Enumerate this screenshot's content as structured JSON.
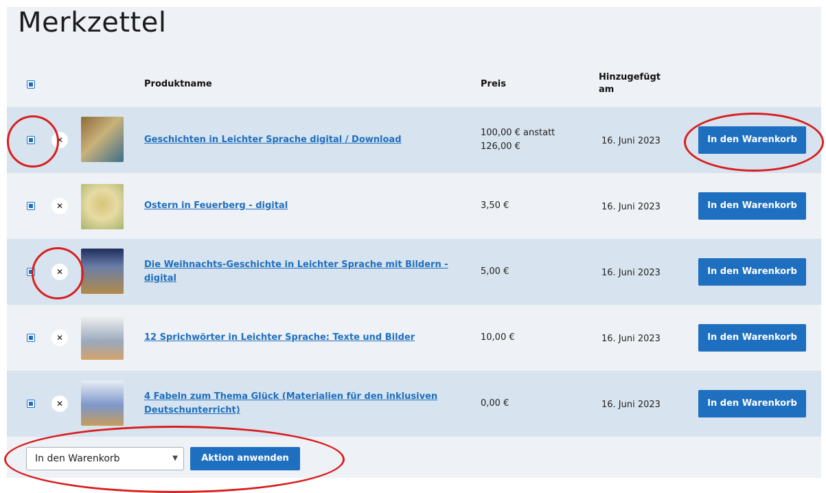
{
  "page": {
    "title": "Merkzettel"
  },
  "table": {
    "headers": {
      "name": "Produktname",
      "price": "Preis",
      "added": "Hinzugefügt am"
    },
    "rows": [
      {
        "name": "Geschichten in Leichter Sprache digital / Download",
        "price": "100,00 € anstatt 126,00 €",
        "date": "16. Juni 2023",
        "action": "In den Warenkorb",
        "thumb_colors": [
          "#8f6a3a",
          "#c9b27a",
          "#3d6e8a"
        ]
      },
      {
        "name": "Ostern in Feuerberg - digital",
        "price": "3,50 €",
        "date": "16. Juni 2023",
        "action": "In den Warenkorb",
        "thumb_colors": [
          "#d8c47a",
          "#a6b46c",
          "#e7dba4"
        ]
      },
      {
        "name": "Die Weihnachts-Geschichte in Leichter Sprache mit Bildern - digital",
        "price": "5,00 €",
        "date": "16. Juni 2023",
        "action": "In den Warenkorb",
        "thumb_colors": [
          "#1f2d5c",
          "#b28a4a",
          "#6a7ea8"
        ]
      },
      {
        "name": "12 Sprichwörter in Leichter Sprache: Texte und Bilder",
        "price": "10,00 €",
        "date": "16. Juni 2023",
        "action": "In den Warenkorb",
        "thumb_colors": [
          "#f4f4f4",
          "#9aa8bc",
          "#d4a36a"
        ]
      },
      {
        "name": "4 Fabeln zum Thema Glück (Materialien für den inklusiven Deutschunterricht)",
        "price": "0,00 €",
        "date": "16. Juni 2023",
        "action": "In den Warenkorb",
        "thumb_colors": [
          "#e9eef6",
          "#7d97c9",
          "#c79c5b"
        ]
      }
    ]
  },
  "bulk": {
    "select_value": "In den Warenkorb",
    "apply_label": "Aktion anwenden"
  },
  "colors": {
    "accent": "#1e6fc0",
    "row_shade": "#d7e3ee",
    "annotation": "#d81e1e"
  }
}
